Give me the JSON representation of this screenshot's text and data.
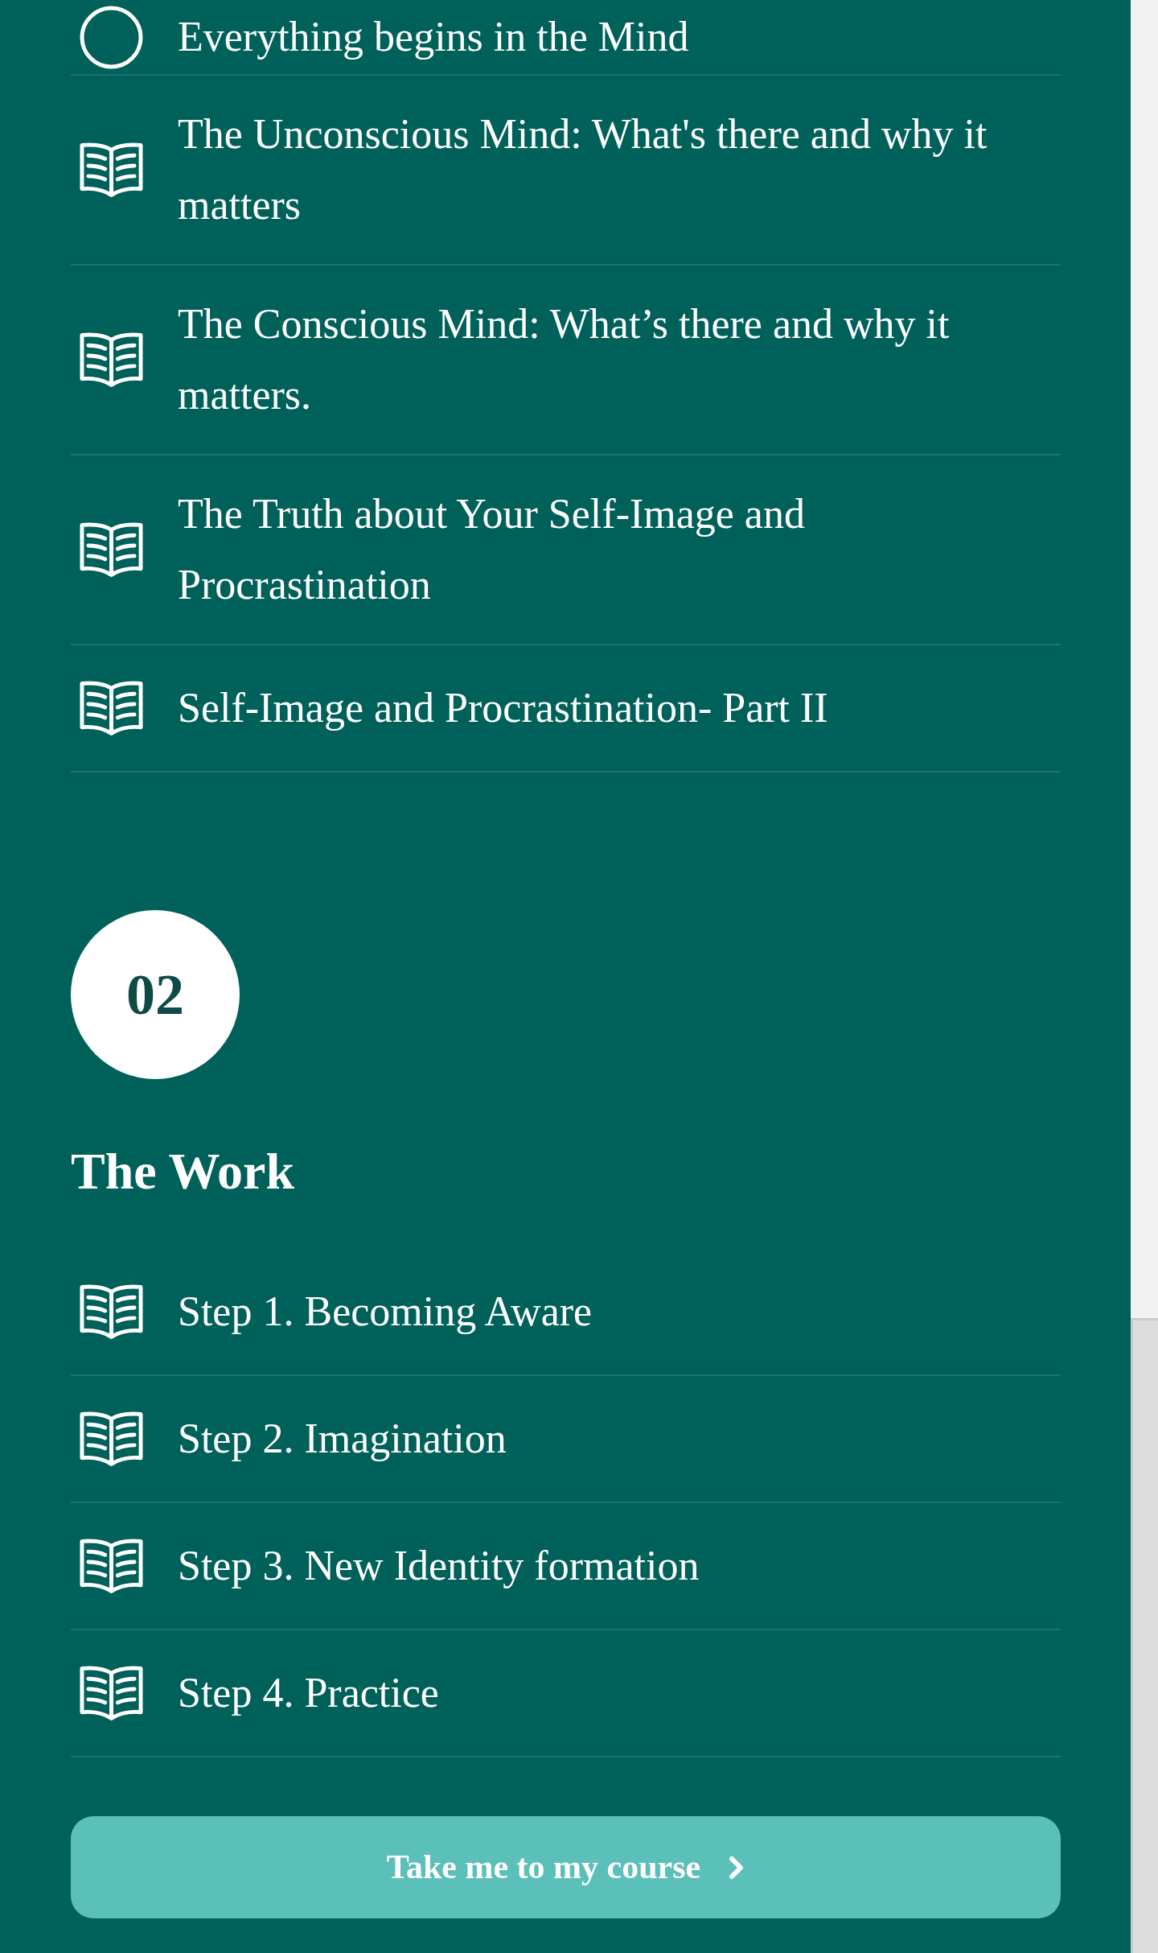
{
  "modules": [
    {
      "lessons": [
        {
          "kind": "circle",
          "title": "Everything begins in the Mind"
        },
        {
          "kind": "book",
          "title": "The Unconscious Mind: What's there and why it matters"
        },
        {
          "kind": "book",
          "title": "The Conscious Mind: What’s there and why it matters."
        },
        {
          "kind": "book",
          "title": "The Truth about Your Self-Image and Procrastination"
        },
        {
          "kind": "book",
          "title": "Self-Image and Procrastination- Part II"
        }
      ]
    },
    {
      "number": "02",
      "title": "The Work",
      "lessons": [
        {
          "kind": "book",
          "title": "Step 1. Becoming Aware"
        },
        {
          "kind": "book",
          "title": "Step 2. Imagination"
        },
        {
          "kind": "book",
          "title": "Step 3. New Identity formation"
        },
        {
          "kind": "book",
          "title": "Step 4. Practice"
        }
      ]
    }
  ],
  "button": {
    "label": "Take me to my course"
  }
}
